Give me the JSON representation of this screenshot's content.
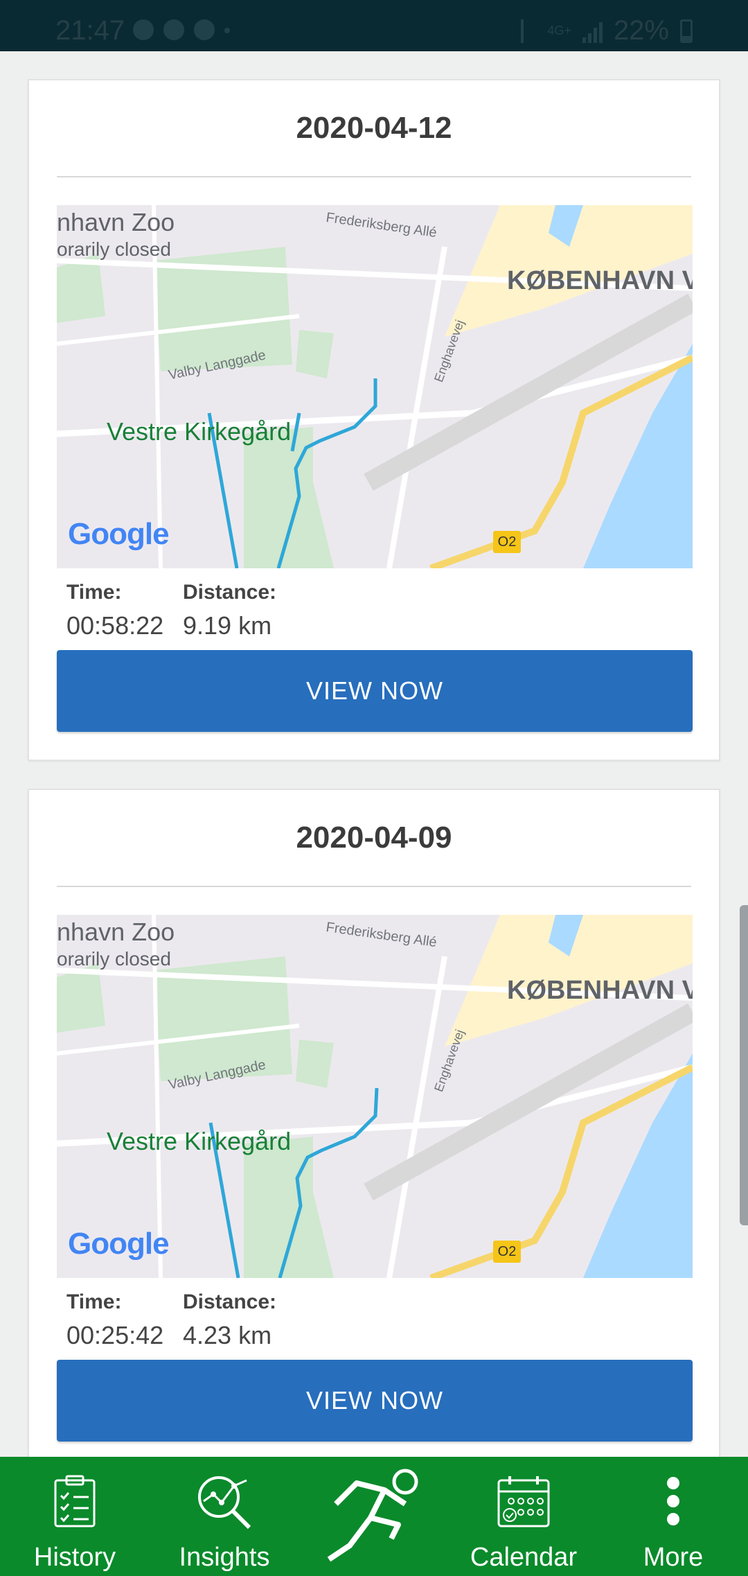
{
  "status_bar": {
    "time": "21:47",
    "network": "4G+",
    "battery_percent": "22%",
    "battery_level": 0.22
  },
  "activities": [
    {
      "date": "2020-04-12",
      "time_label": "Time:",
      "time_value": "00:58:22",
      "distance_label": "Distance:",
      "distance_value": "9.19 km",
      "button_label": "VIEW NOW"
    },
    {
      "date": "2020-04-09",
      "time_label": "Time:",
      "time_value": "00:25:42",
      "distance_label": "Distance:",
      "distance_value": "4.23 km",
      "button_label": "VIEW NOW"
    }
  ],
  "map_labels": {
    "zoo": "nhavn Zoo",
    "closed": "orarily closed",
    "frederiksberg": "Frederiksberg Allé",
    "kobenhavn": "KØBENHAVN V",
    "valby": "Valby Langgade",
    "enghavevej": "Enghavevej",
    "vestre": "Vestre Kirkegård",
    "google": "Google",
    "road_badge": "O2"
  },
  "bottom_nav": [
    {
      "label": "History",
      "icon": "clipboard-list-icon"
    },
    {
      "label": "Insights",
      "icon": "magnifier-chart-icon"
    },
    {
      "label": "",
      "icon": "runner-icon"
    },
    {
      "label": "Calendar",
      "icon": "calendar-icon"
    },
    {
      "label": "More",
      "icon": "more-vertical-icon"
    }
  ],
  "colors": {
    "status_bar": "#0a2a33",
    "accent_button": "#276ebd",
    "nav_background": "#0a8a2b",
    "route": "#2ea7d8",
    "park_green": "#188038"
  }
}
